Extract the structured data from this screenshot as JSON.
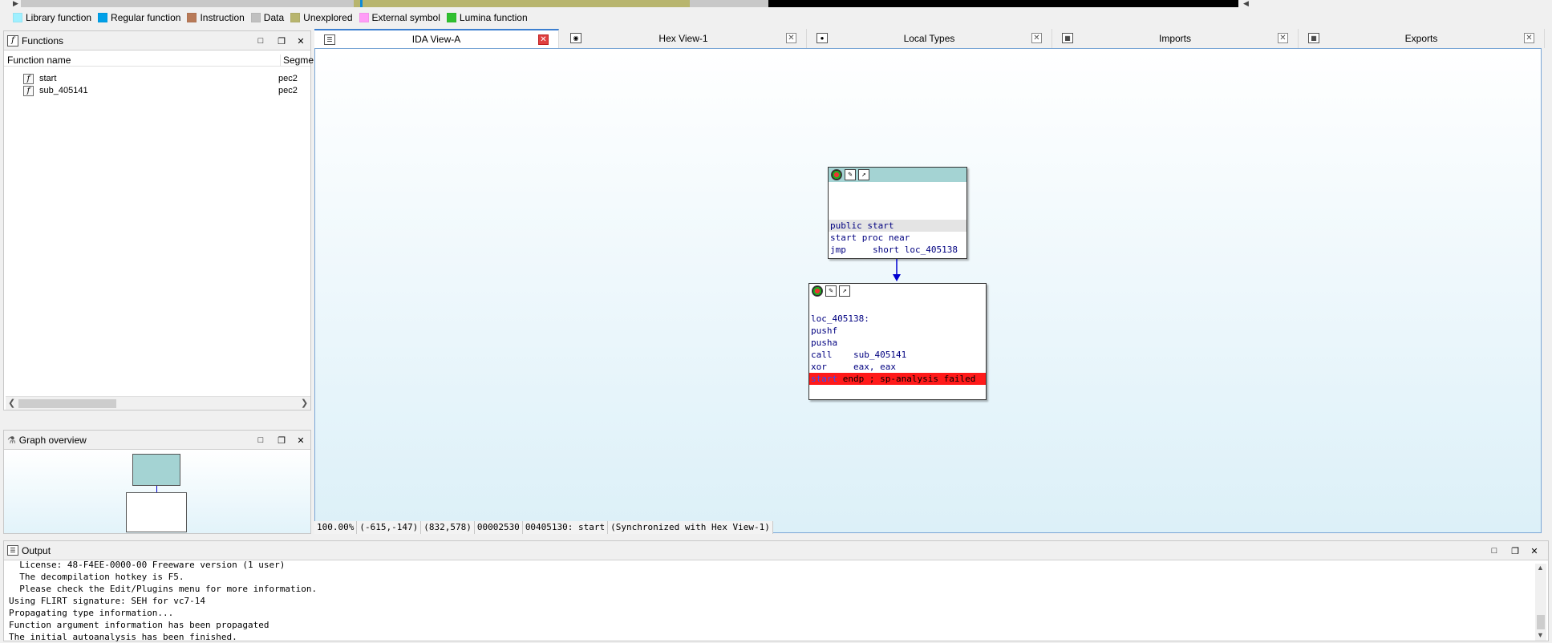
{
  "navband": {
    "colors": {
      "unexplored": "#b5b36e",
      "regular": "#0e8ad8",
      "gray": "#c8c8c8",
      "black": "#000000"
    }
  },
  "legend": [
    {
      "label": "Library function",
      "color": "#9ff0ff"
    },
    {
      "label": "Regular function",
      "color": "#00a0e8"
    },
    {
      "label": "Instruction",
      "color": "#b87a58"
    },
    {
      "label": "Data",
      "color": "#c0c0c0"
    },
    {
      "label": "Unexplored",
      "color": "#b8b56e"
    },
    {
      "label": "External symbol",
      "color": "#ff9cf7"
    },
    {
      "label": "Lumina function",
      "color": "#30c030"
    }
  ],
  "functions_panel": {
    "title": "Functions",
    "col_name": "Function name",
    "col_segment": "Segme",
    "rows": [
      {
        "name": "start",
        "segment": "pec2"
      },
      {
        "name": "sub_405141",
        "segment": "pec2"
      }
    ]
  },
  "graph_overview": {
    "title": "Graph overview"
  },
  "tabs": [
    {
      "label": "IDA View-A",
      "icon": "ida-view-icon",
      "active": true
    },
    {
      "label": "Hex View-1",
      "icon": "hex-view-icon",
      "active": false
    },
    {
      "label": "Local Types",
      "icon": "local-types-icon",
      "active": false
    },
    {
      "label": "Imports",
      "icon": "imports-icon",
      "active": false
    },
    {
      "label": "Exports",
      "icon": "exports-icon",
      "active": false
    }
  ],
  "graph": {
    "node1": {
      "lines": [
        "public start",
        "start proc near",
        "jmp     short loc_405138"
      ]
    },
    "node2": {
      "lines": [
        "loc_405138:",
        "pushf",
        "pusha",
        "call    sub_405141",
        "xor     eax, eax"
      ],
      "err_label": "start",
      "err_rest": " endp ; sp-analysis failed"
    }
  },
  "status": {
    "zoom": "100.00%",
    "coords1": "(-615,-147)",
    "coords2": "(832,578)",
    "offset": "00002530",
    "location": "00405130: start",
    "sync": "(Synchronized with Hex View-1)"
  },
  "output": {
    "title": "Output",
    "lines": [
      "  License: 48-F4EE-0000-00 Freeware version (1 user)",
      "  The decompilation hotkey is F5.",
      "  Please check the Edit/Plugins menu for more information.",
      "Using FLIRT signature: SEH for vc7-14",
      "Propagating type information...",
      "Function argument information has been propagated",
      "The initial autoanalysis has been finished."
    ]
  }
}
